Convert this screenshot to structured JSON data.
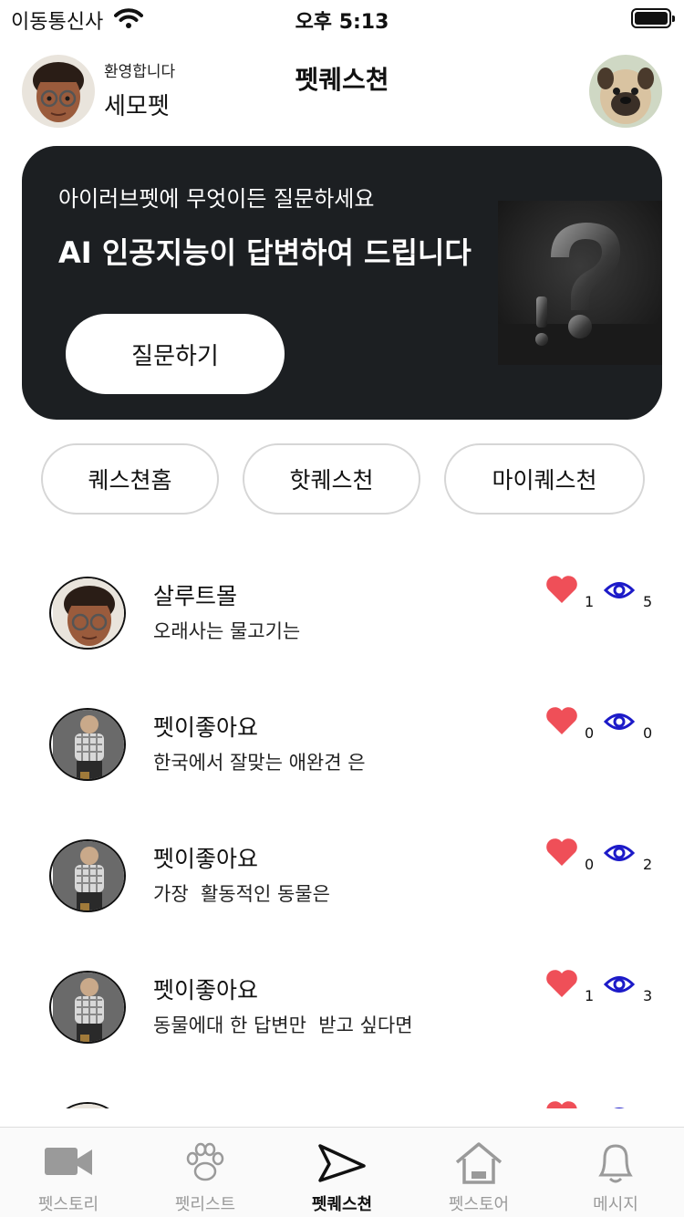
{
  "status_bar": {
    "carrier": "이동통신사",
    "time": "오후 5:13"
  },
  "header": {
    "welcome": "환영합니다",
    "username": "세모펫",
    "title": "펫퀘스쳔"
  },
  "banner": {
    "subtitle": "아이러브펫에 무엇이든 질문하세요",
    "headline": "AI 인공지능이 답변하여 드립니다",
    "button_label": "질문하기"
  },
  "tabs": [
    {
      "label": "퀘스쳔홈"
    },
    {
      "label": "핫퀘스천"
    },
    {
      "label": "마이퀘스천"
    }
  ],
  "questions": [
    {
      "author": "살루트몰",
      "title": "오래사는 물고기는",
      "likes": "1",
      "views": "5",
      "avatar": "memoji-avatar"
    },
    {
      "author": "펫이좋아요",
      "title": "한국에서 잘맞는 애완견 은",
      "likes": "0",
      "views": "0",
      "avatar": "person-avatar"
    },
    {
      "author": "펫이좋아요",
      "title": "가장  활동적인 동물은",
      "likes": "0",
      "views": "2",
      "avatar": "person-avatar"
    },
    {
      "author": "펫이좋아요",
      "title": "동물에대 한 답변만  받고 싶다면",
      "likes": "1",
      "views": "3",
      "avatar": "person-avatar"
    },
    {
      "author": "",
      "title": "",
      "likes": "",
      "views": "",
      "avatar": "memoji-avatar"
    }
  ],
  "tab_bar": [
    {
      "label": "펫스토리",
      "icon": "video-camera-icon"
    },
    {
      "label": "펫리스트",
      "icon": "paw-icon"
    },
    {
      "label": "펫퀘스쳔",
      "icon": "send-arrow-icon"
    },
    {
      "label": "펫스토어",
      "icon": "home-icon"
    },
    {
      "label": "메시지",
      "icon": "bell-icon"
    }
  ],
  "colors": {
    "banner_bg": "#1c1f22",
    "heart": "#ef4f58",
    "eye": "#1c1ac8",
    "tab_inactive": "#9a9a9a"
  }
}
